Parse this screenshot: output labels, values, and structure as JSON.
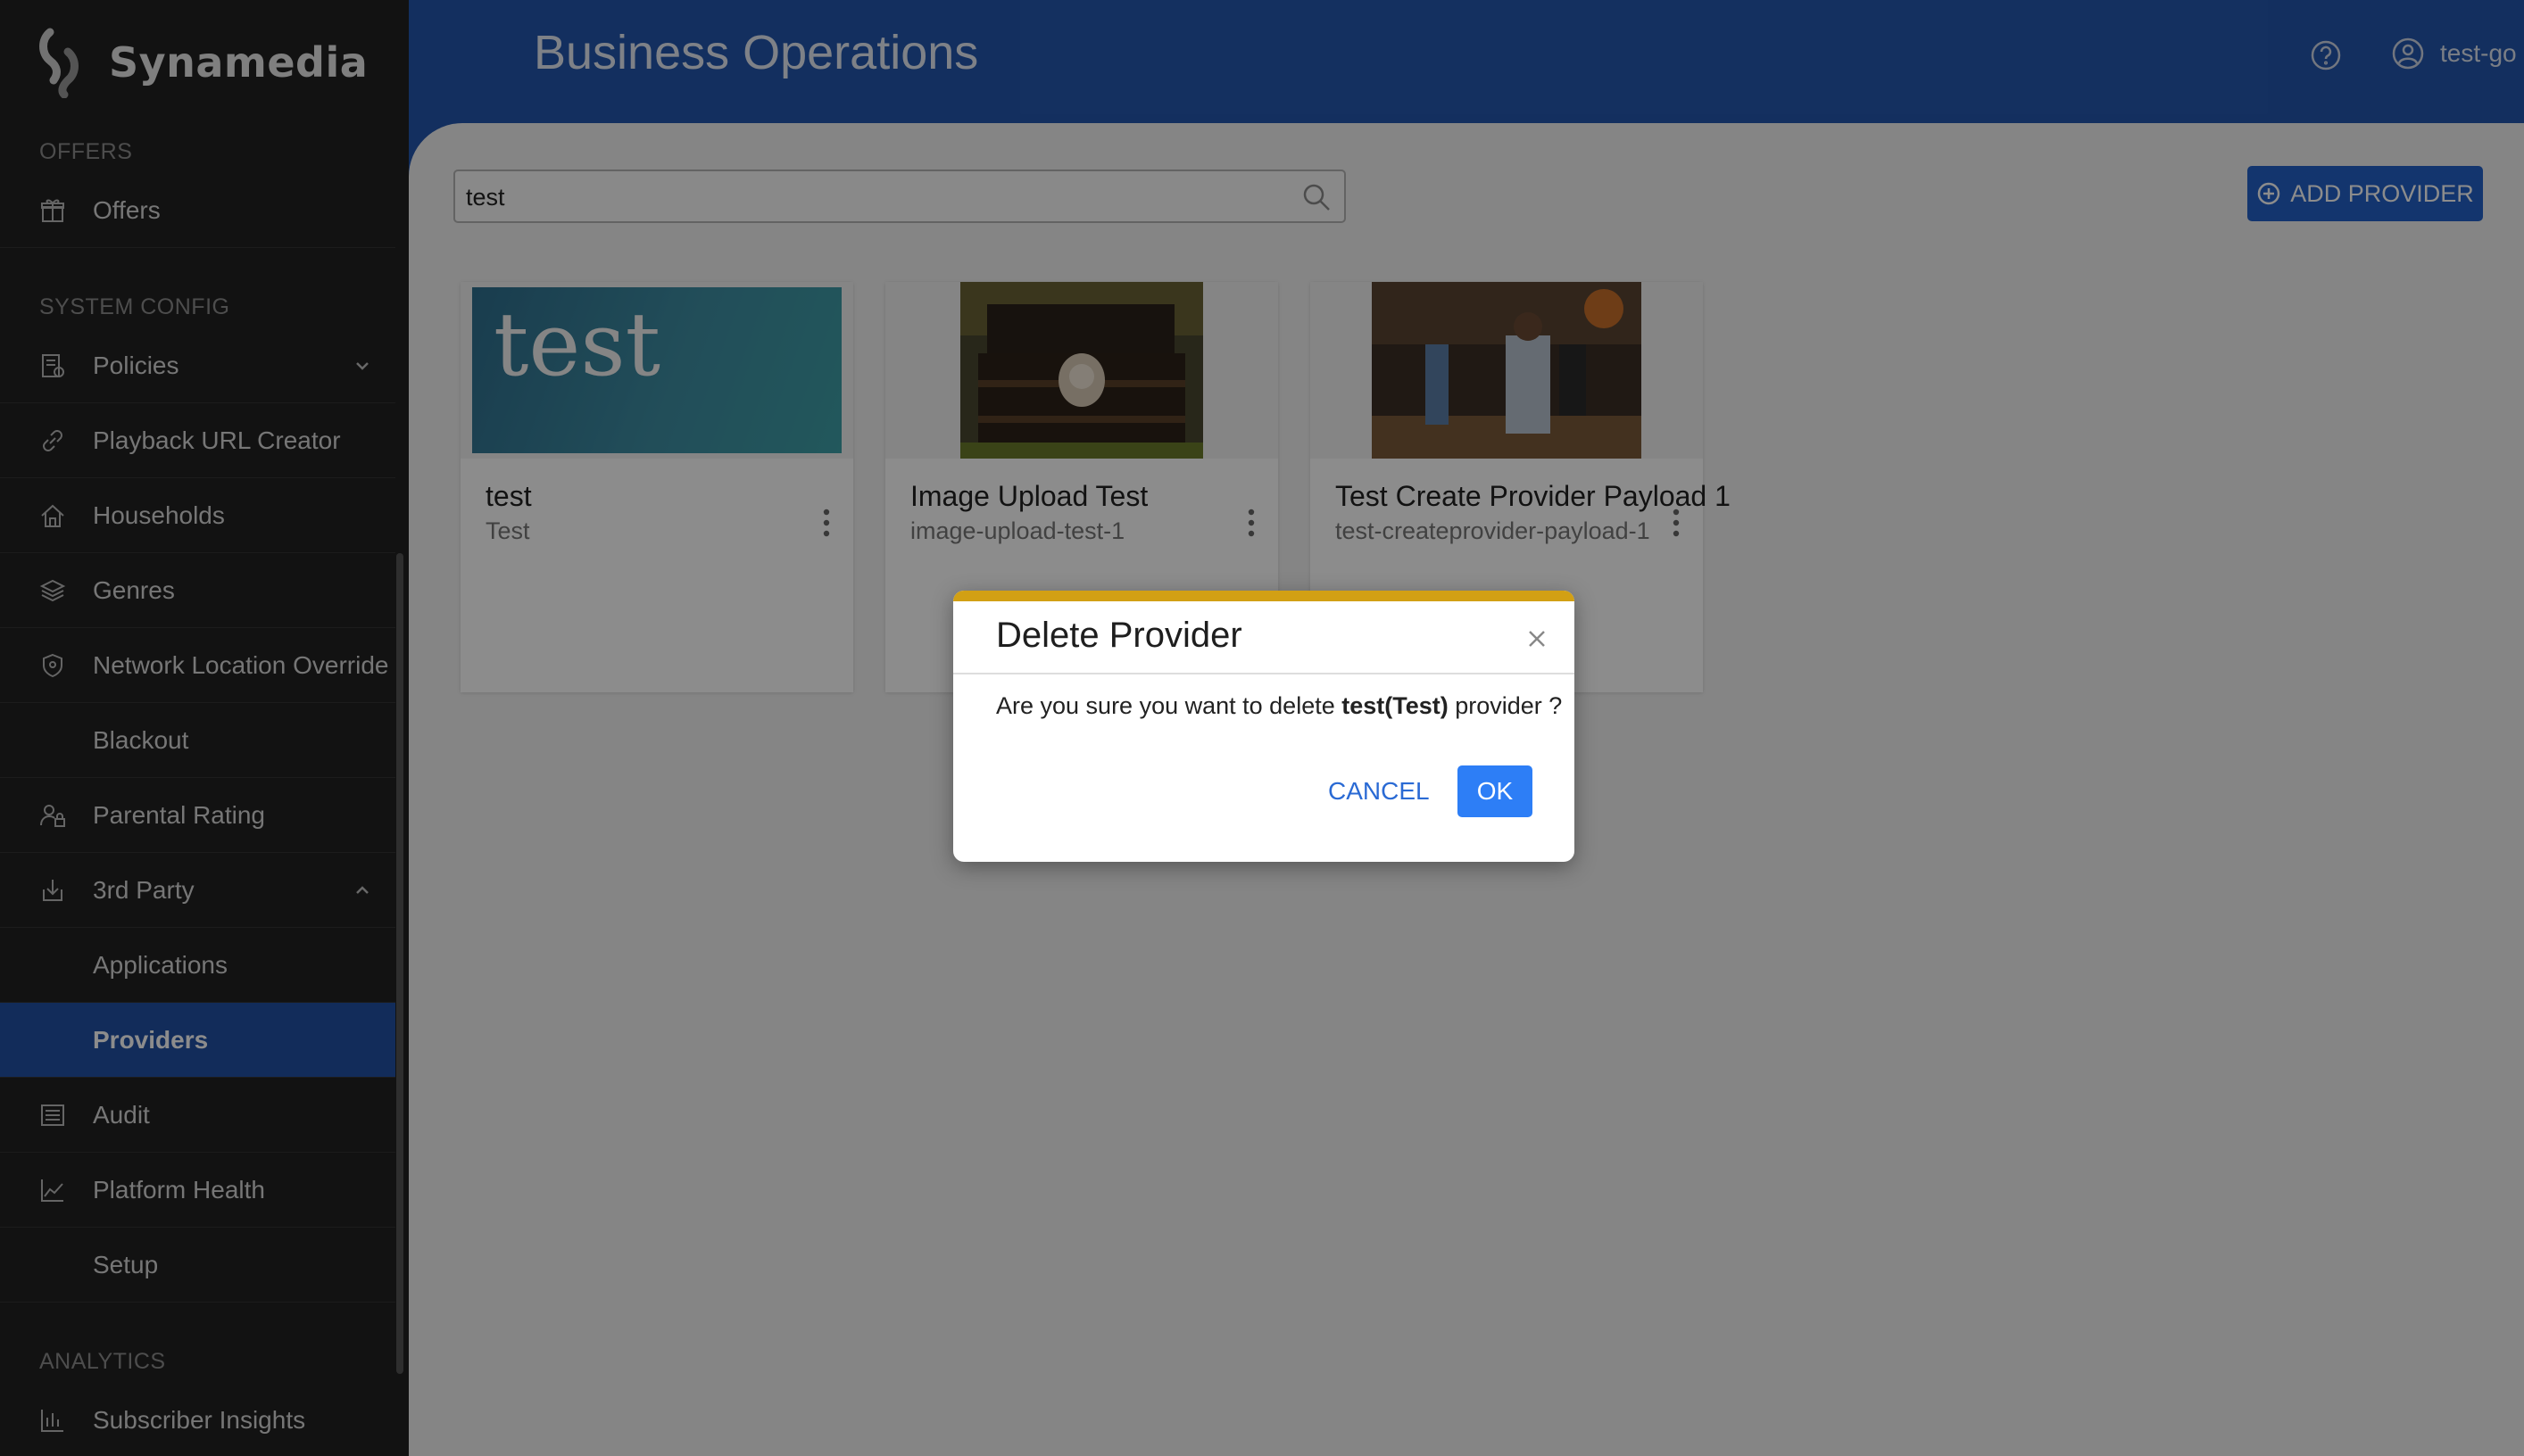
{
  "brand": {
    "name": "Synamedia"
  },
  "header": {
    "title": "Business Operations",
    "user": "test-go",
    "icons": {
      "help": "help-circle-icon",
      "user": "user-circle-icon"
    }
  },
  "sidebar": {
    "sections": {
      "offers": "OFFERS",
      "system_config": "SYSTEM CONFIG",
      "analytics": "ANALYTICS"
    },
    "items": [
      {
        "label": "Offers",
        "icon": "gift-icon"
      },
      {
        "label": "Policies",
        "icon": "policy-icon",
        "expand": "chevron-down"
      },
      {
        "label": "Playback URL Creator",
        "icon": "link-icon"
      },
      {
        "label": "Households",
        "icon": "home-icon"
      },
      {
        "label": "Genres",
        "icon": "layers-icon"
      },
      {
        "label": "Network Location Override",
        "icon": "shield-icon"
      },
      {
        "label": "Blackout",
        "icon": ""
      },
      {
        "label": "Parental Rating",
        "icon": "user-lock-icon"
      },
      {
        "label": "3rd Party",
        "icon": "download-icon",
        "expand": "chevron-up"
      },
      {
        "label": "Applications",
        "icon": ""
      },
      {
        "label": "Providers",
        "icon": "",
        "active": true
      },
      {
        "label": "Audit",
        "icon": "list-icon"
      },
      {
        "label": "Platform Health",
        "icon": "chart-line-icon"
      },
      {
        "label": "Setup",
        "icon": ""
      },
      {
        "label": "Subscriber Insights",
        "icon": "bar-chart-icon"
      }
    ]
  },
  "search": {
    "value": "test",
    "icon": "search-icon"
  },
  "add_provider": {
    "label": "ADD PROVIDER",
    "icon": "plus-circle-icon"
  },
  "providers": [
    {
      "name": "test",
      "id": "Test",
      "thumb_text": "test"
    },
    {
      "name": "Image Upload Test",
      "id": "image-upload-test-1"
    },
    {
      "name": "Test Create Provider Payload 1",
      "id": "test-createprovider-payload-1"
    }
  ],
  "modal": {
    "title": "Delete Provider",
    "message_prefix": "Are you sure you want to delete ",
    "message_bold": "test(Test)",
    "message_suffix": " provider ?",
    "cancel": "CANCEL",
    "ok": "OK",
    "accent": "#d2a014"
  },
  "colors": {
    "header_blue": "#2457ae",
    "sidebar_bg": "#212121",
    "active_item": "#2150a4",
    "primary_button": "#2361c8",
    "ok_button": "#2d7ef6"
  }
}
